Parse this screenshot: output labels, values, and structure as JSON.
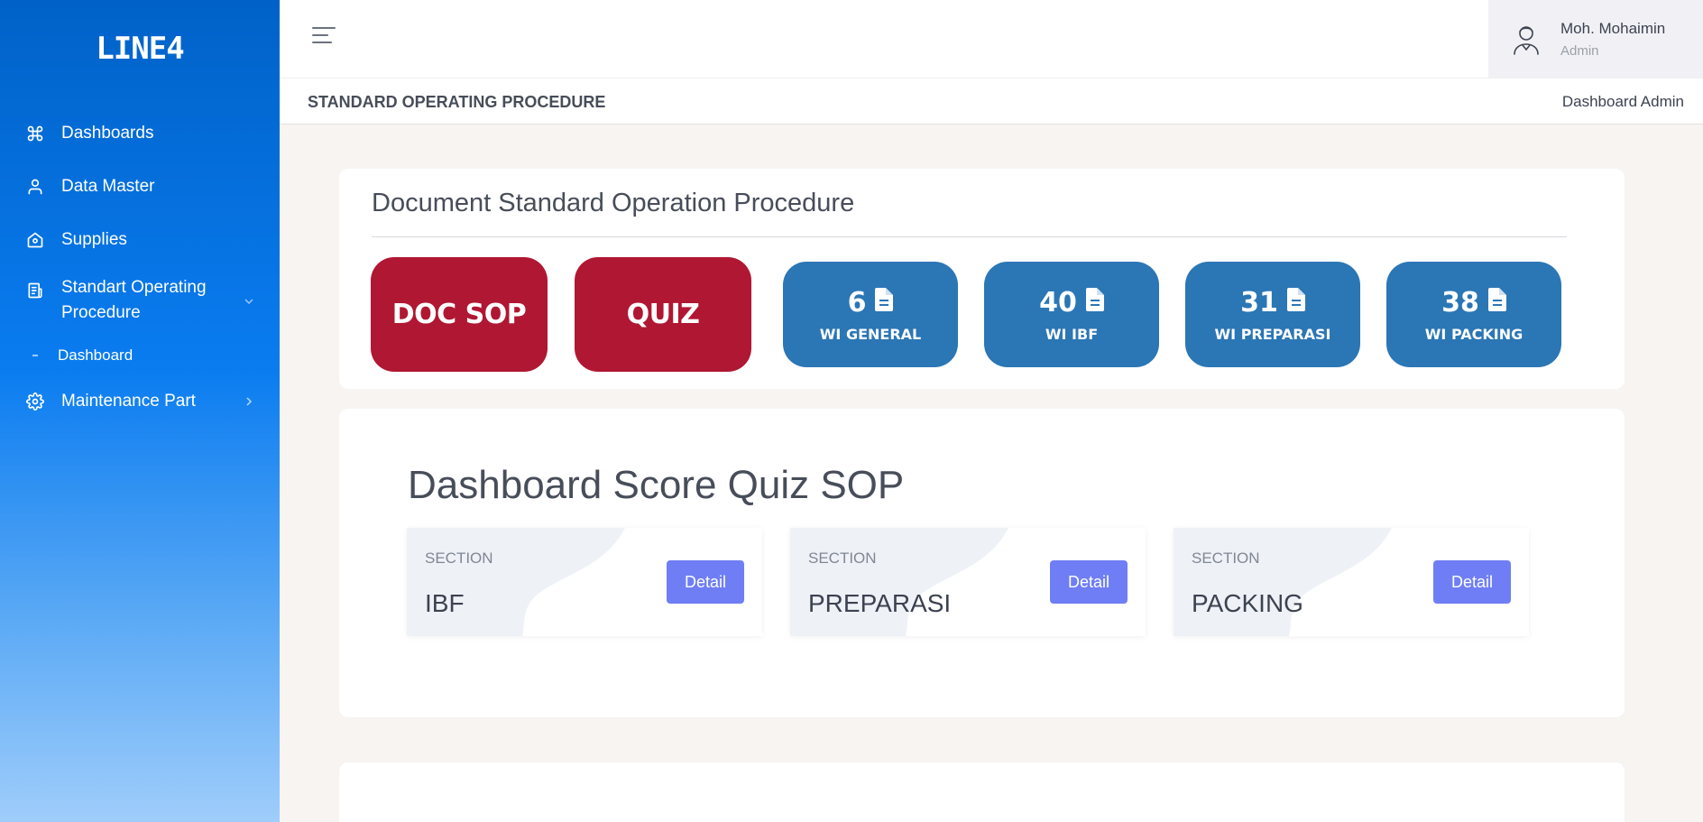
{
  "app": {
    "logo": "LINE4"
  },
  "sidebar": {
    "items": [
      {
        "label": "Dashboards",
        "icon": "command-icon"
      },
      {
        "label": "Data Master",
        "icon": "user-icon"
      },
      {
        "label": "Supplies",
        "icon": "home-icon"
      },
      {
        "label": "Standart Operating Procedure",
        "icon": "document-icon",
        "expanded": true,
        "children": [
          {
            "label": "Dashboard"
          }
        ]
      },
      {
        "label": "Maintenance Part",
        "icon": "gear-icon"
      }
    ]
  },
  "header": {
    "user_name": "Moh. Mohaimin",
    "user_role": "Admin"
  },
  "subheader": {
    "page_title": "STANDARD OPERATING PROCEDURE",
    "breadcrumb": "Dashboard Admin"
  },
  "documents": {
    "title": "Document Standard Operation Procedure",
    "buttons": [
      {
        "label": "DOC SOP",
        "color": "#b01732"
      },
      {
        "label": "QUIZ",
        "color": "#b01732"
      }
    ],
    "stats": [
      {
        "count": "6",
        "label": "WI GENERAL",
        "color": "#2b76b5"
      },
      {
        "count": "40",
        "label": "WI IBF",
        "color": "#2b76b5"
      },
      {
        "count": "31",
        "label": "WI PREPARASI",
        "color": "#2b76b5"
      },
      {
        "count": "38",
        "label": "WI PACKING",
        "color": "#2b76b5"
      }
    ]
  },
  "quiz": {
    "title": "Dashboard Score Quiz SOP",
    "sections": [
      {
        "caption": "SECTION",
        "name": "IBF",
        "action": "Detail"
      },
      {
        "caption": "SECTION",
        "name": "PREPARASI",
        "action": "Detail"
      },
      {
        "caption": "SECTION",
        "name": "PACKING",
        "action": "Detail"
      }
    ]
  },
  "colors": {
    "accent": "#0a7cf0",
    "detail_button": "#6f7ef5"
  }
}
